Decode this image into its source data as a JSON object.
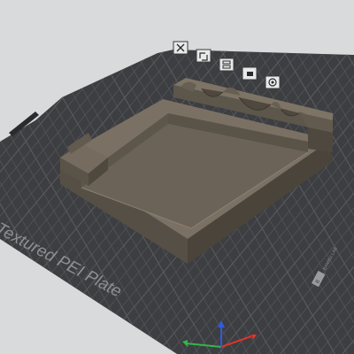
{
  "viewport": {
    "background_color": "#d9dadb"
  },
  "build_plate": {
    "label": "Textured PEI Plate",
    "color": "#3d3e41",
    "grid_color": "#5a5b5e",
    "logo_text": "BAMBU LAB"
  },
  "model": {
    "color": "#6a6155",
    "shadow_color": "#4d463d",
    "highlight_color": "#7d7466"
  },
  "plate_toolbar": {
    "items": [
      {
        "name": "close-plate-icon",
        "glyph": "✕"
      },
      {
        "name": "auto-orient-icon",
        "glyph": "⟲"
      },
      {
        "name": "arrange-icon",
        "glyph": "▦"
      },
      {
        "name": "lock-plate-icon",
        "glyph": "■"
      },
      {
        "name": "plate-settings-icon",
        "glyph": "◎"
      }
    ]
  },
  "axes": {
    "x_color": "#e0342b",
    "y_color": "#2fb84a",
    "z_color": "#2f5be0"
  }
}
